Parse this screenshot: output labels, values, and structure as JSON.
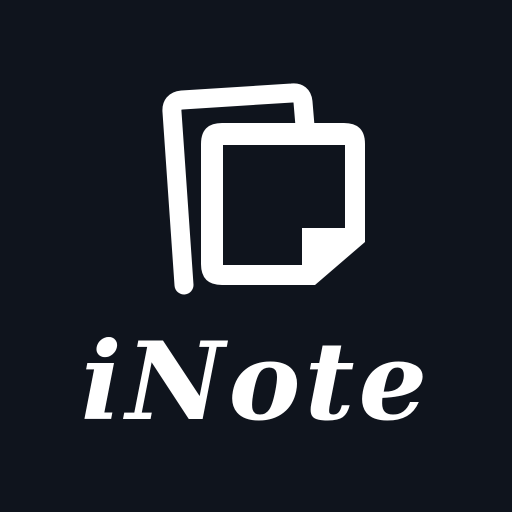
{
  "app": {
    "name": "iNote",
    "icon": "stacked-notes-icon"
  },
  "colors": {
    "background": "#0f141d",
    "foreground": "#ffffff"
  }
}
